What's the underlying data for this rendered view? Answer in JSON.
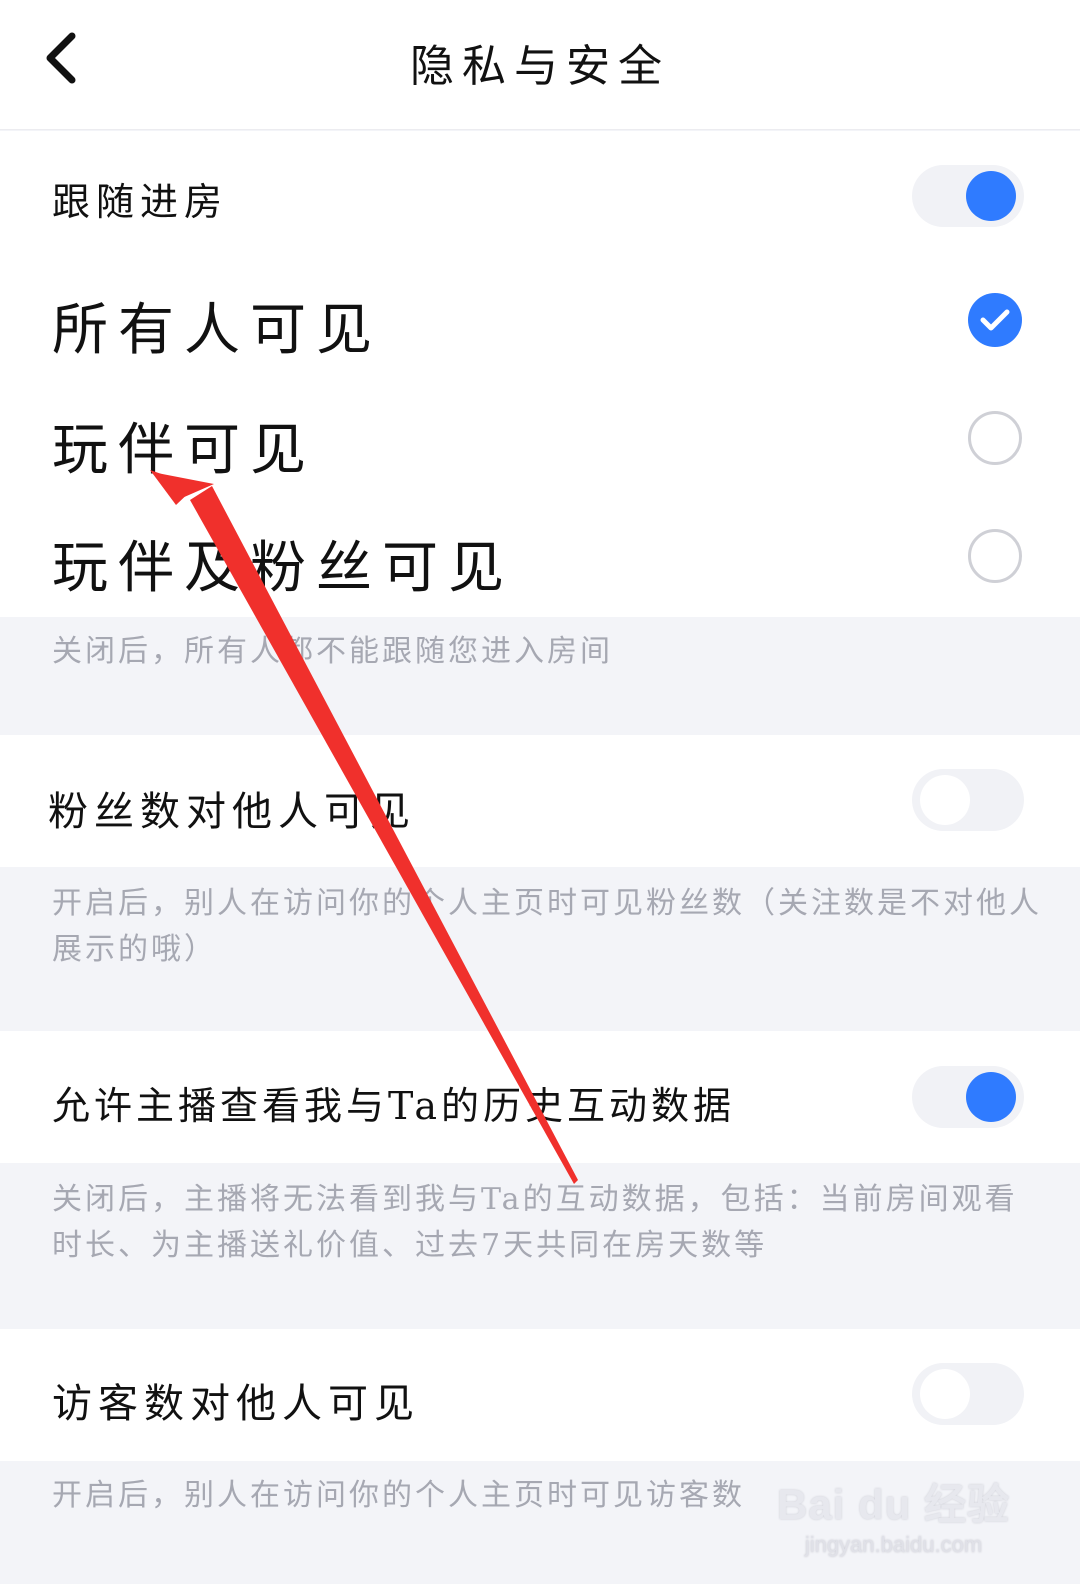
{
  "header": {
    "title": "隐私与安全",
    "back_icon": "chevron-left-icon"
  },
  "follow": {
    "label": "跟随进房",
    "enabled": true,
    "options": [
      {
        "label": "所有人可见",
        "selected": true
      },
      {
        "label": "玩伴可见",
        "selected": false
      },
      {
        "label": "玩伴及粉丝可见",
        "selected": false
      }
    ],
    "description": "关闭后，所有人都不能跟随您进入房间"
  },
  "fans_visible": {
    "label": "粉丝数对他人可见",
    "enabled": false,
    "description": "开启后，别人在访问你的个人主页时可见粉丝数（关注数是不对他人展示的哦）"
  },
  "interaction_data": {
    "label": "允许主播查看我与Ta的历史互动数据",
    "enabled": true,
    "description": "关闭后，主播将无法看到我与Ta的互动数据，包括：当前房间观看时长、为主播送礼价值、过去7天共同在房天数等"
  },
  "visitors_visible": {
    "label": "访客数对他人可见",
    "enabled": false,
    "description": "开启后，别人在访问你的个人主页时可见访客数"
  },
  "watermark": {
    "logo": "Bai du 经验",
    "url": "jingyan.baidu.com"
  },
  "colors": {
    "accent": "#2f7bff",
    "annotation_arrow": "#f0302c",
    "description_text": "#a6a8b2",
    "section_gap": "#f3f4f8"
  }
}
